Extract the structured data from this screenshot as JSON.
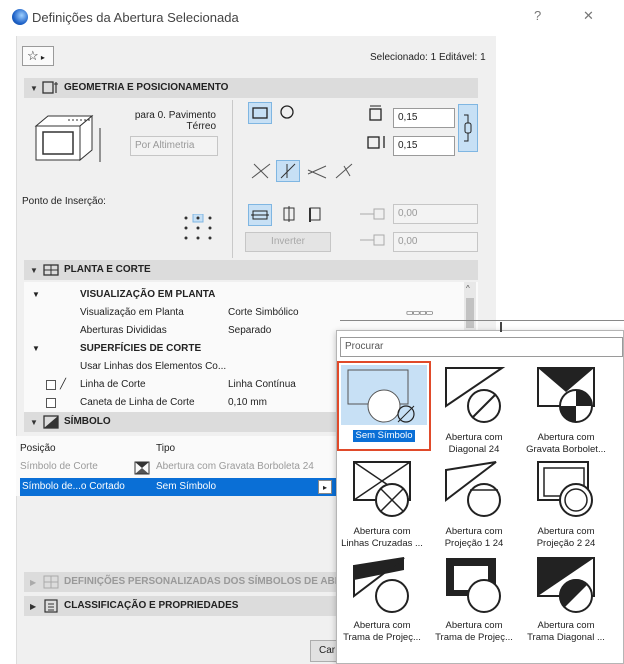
{
  "window": {
    "title": "Definições da Abertura Selecionada",
    "help": "?",
    "close": "✕"
  },
  "toolbar": {
    "favorites_icon": "star-icon",
    "selected_info": "Selecionado: 1 Editável: 1"
  },
  "geometry": {
    "header": "GEOMETRIA E POSICIONAMENTO",
    "story_line1": "para 0. Pavimento",
    "story_line2": "Térreo",
    "altimetry": "Por Altimetria",
    "insertion_point": "Ponto de Inserção:",
    "width": "0,15",
    "height": "0,15",
    "offset1": "0,00",
    "offset2": "0,00",
    "invert": "Inverter"
  },
  "plan": {
    "header": "PLANTA E CORTE",
    "rows": [
      {
        "label": "VISUALIZAÇÃO EM PLANTA",
        "value": "",
        "bold": true
      },
      {
        "label": "Visualização em Planta",
        "value": "Corte Simbólico"
      },
      {
        "label": "Aberturas Divididas",
        "value": "Separado"
      },
      {
        "label": "SUPERFÍCIES DE CORTE",
        "value": "",
        "bold": true
      },
      {
        "label": "Usar Linhas dos Elementos Co...",
        "value": ""
      },
      {
        "label": "Linha de Corte",
        "value": "Linha Contínua"
      },
      {
        "label": "Caneta de Linha de Corte",
        "value": "0,10 mm"
      }
    ]
  },
  "symbol": {
    "header": "SÍMBOLO",
    "col_position": "Posição",
    "col_type": "Tipo",
    "rows": [
      {
        "position": "Símbolo de Corte",
        "type": "Abertura com Gravata Borboleta 24"
      },
      {
        "position": "Símbolo de...o Cortado",
        "type": "Sem Símbolo"
      }
    ]
  },
  "custom": {
    "header": "DEFINIÇÕES PERSONALIZADAS DOS SÍMBOLOS DE ABERT"
  },
  "classification": {
    "header": "CLASSIFICAÇÃO E PROPRIEDADES"
  },
  "footer": {
    "cancel": "Car"
  },
  "popup": {
    "search_placeholder": "Procurar",
    "items": [
      {
        "line1": "Sem Símbolo",
        "line2": ""
      },
      {
        "line1": "Abertura com",
        "line2": "Diagonal 24"
      },
      {
        "line1": "Abertura com",
        "line2": "Gravata Borbolet..."
      },
      {
        "line1": "Abertura com",
        "line2": "Linhas Cruzadas ..."
      },
      {
        "line1": "Abertura com",
        "line2": "Projeção 1 24"
      },
      {
        "line1": "Abertura com",
        "line2": "Projeção 2 24"
      },
      {
        "line1": "Abertura com",
        "line2": "Trama de Projeç..."
      },
      {
        "line1": "Abertura com",
        "line2": "Trama de Projeç..."
      },
      {
        "line1": "Abertura com",
        "line2": "Trama Diagonal ..."
      }
    ]
  }
}
